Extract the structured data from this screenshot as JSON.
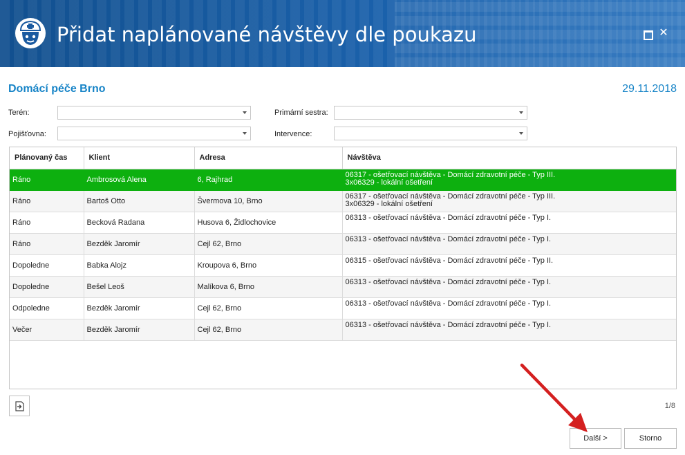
{
  "window": {
    "title": "Přidat naplánované návštěvy dle poukazu",
    "icon": "nurse-icon",
    "controls": {
      "maximize_icon": "maximize-icon",
      "close_icon": "close-icon",
      "close_glyph": "✕"
    }
  },
  "header": {
    "organization": "Domácí péče Brno",
    "date": "29.11.2018"
  },
  "filters": {
    "teren_label": "Terén:",
    "teren_value": "",
    "pojistovna_label": "Pojišťovna:",
    "pojistovna_value": "",
    "sestra_label": "Primární sestra:",
    "sestra_value": "",
    "intervence_label": "Intervence:",
    "intervence_value": ""
  },
  "grid": {
    "columns": [
      "Plánovaný čas",
      "Klient",
      "Adresa",
      "Návštěva"
    ],
    "rows": [
      {
        "time": "Ráno",
        "client": "Ambrosová Alena",
        "address": "6, Rajhrad",
        "visit1": "06317 - ošetřovací návštěva - Domácí zdravotní péče - Typ III.",
        "visit2": "3x06329 - lokální ošetření"
      },
      {
        "time": "Ráno",
        "client": "Bartoš Otto",
        "address": "Švermova 10, Brno",
        "visit1": "06317 - ošetřovací návštěva - Domácí zdravotní péče - Typ III.",
        "visit2": "3x06329 - lokální ošetření"
      },
      {
        "time": "Ráno",
        "client": "Becková Radana",
        "address": "Husova 6, Židlochovice",
        "visit1": "06313 - ošetřovací návštěva - Domácí zdravotní péče - Typ I.",
        "visit2": ""
      },
      {
        "time": "Ráno",
        "client": "Bezděk Jaromír",
        "address": "Cejl 62, Brno",
        "visit1": "06313 - ošetřovací návštěva - Domácí zdravotní péče - Typ I.",
        "visit2": ""
      },
      {
        "time": "Dopoledne",
        "client": "Babka Alojz",
        "address": "Kroupova 6, Brno",
        "visit1": "06315 - ošetřovací návštěva - Domácí zdravotní péče - Typ II.",
        "visit2": ""
      },
      {
        "time": "Dopoledne",
        "client": "Bešel Leoš",
        "address": "Malíkova 6, Brno",
        "visit1": "06313 - ošetřovací návštěva - Domácí zdravotní péče - Typ I.",
        "visit2": ""
      },
      {
        "time": "Odpoledne",
        "client": "Bezděk Jaromír",
        "address": "Cejl 62, Brno",
        "visit1": "06313 - ošetřovací návštěva - Domácí zdravotní péče - Typ I.",
        "visit2": ""
      },
      {
        "time": "Večer",
        "client": "Bezděk Jaromír",
        "address": "Cejl 62, Brno",
        "visit1": "06313 - ošetřovací návštěva - Domácí zdravotní péče - Typ I.",
        "visit2": ""
      }
    ],
    "selected_row_color": "#0db00f"
  },
  "footer": {
    "export_icon": "export-icon",
    "pager": "1/8",
    "next_label": "Další >",
    "cancel_label": "Storno"
  },
  "colors": {
    "titlebar": "#1a5aa0",
    "accent": "#1784c7",
    "annotation_arrow": "#d42020"
  }
}
